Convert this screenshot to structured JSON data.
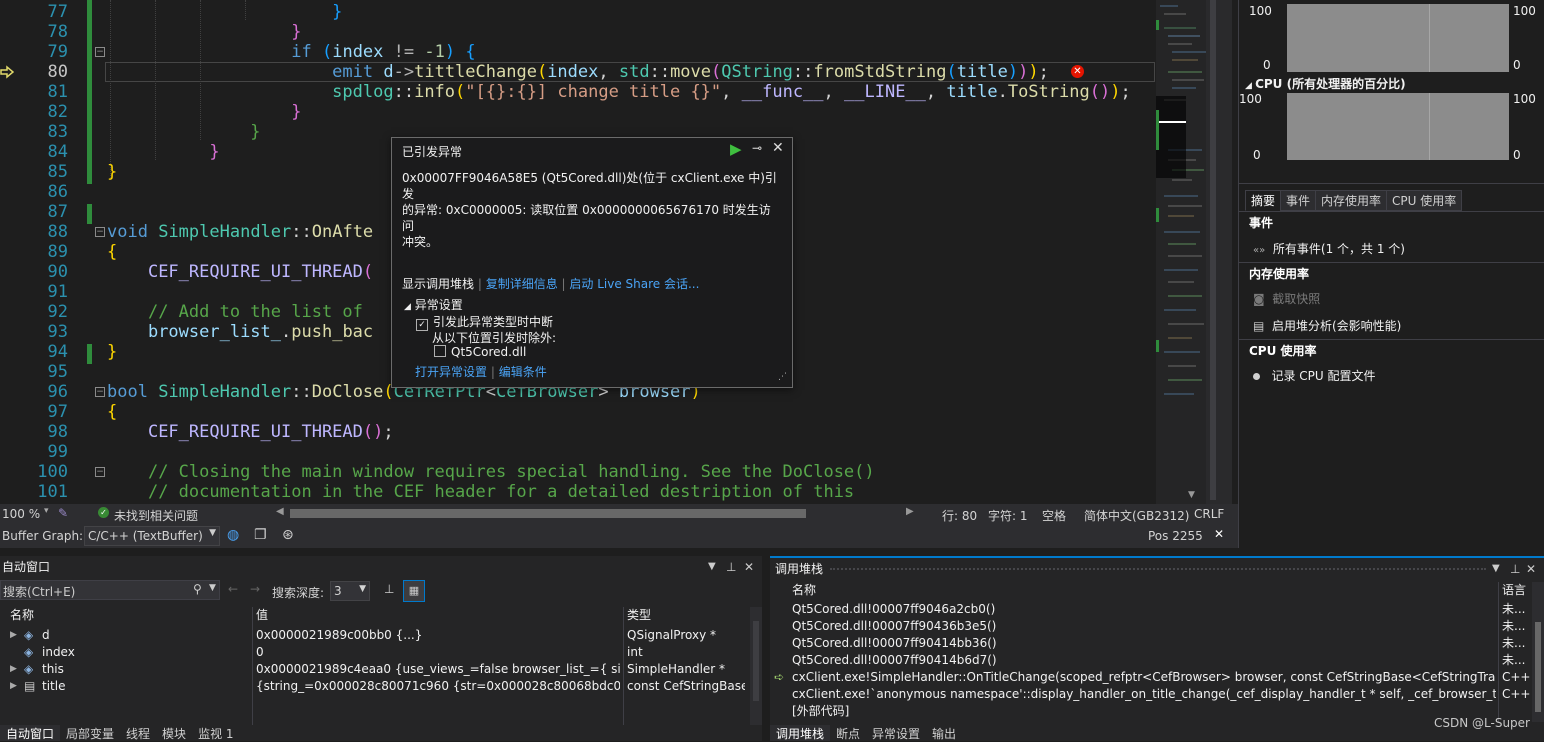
{
  "editor": {
    "lines": [
      {
        "n": "77"
      },
      {
        "n": "78"
      },
      {
        "n": "79"
      },
      {
        "n": "80"
      },
      {
        "n": "81"
      },
      {
        "n": "82"
      },
      {
        "n": "83"
      },
      {
        "n": "84"
      },
      {
        "n": "85"
      },
      {
        "n": "86"
      },
      {
        "n": "87"
      },
      {
        "n": "88"
      },
      {
        "n": "89"
      },
      {
        "n": "90"
      },
      {
        "n": "91"
      },
      {
        "n": "92"
      },
      {
        "n": "93"
      },
      {
        "n": "94"
      },
      {
        "n": "95"
      },
      {
        "n": "96"
      },
      {
        "n": "97"
      },
      {
        "n": "98"
      },
      {
        "n": "99"
      },
      {
        "n": "100"
      },
      {
        "n": "101"
      }
    ],
    "zoom": "100 %",
    "issues": "未找到相关问题",
    "row": "行: 80",
    "col": "字符: 1",
    "whitespace": "空格",
    "encoding": "简体中文(GB2312)",
    "eol": "CRLF",
    "buffer_graph_label": "Buffer Graph:",
    "buffer_graph_value": "C/C++ (TextBuffer)",
    "pos": "Pos 2255"
  },
  "diagnostics": {
    "y_top_left": "100",
    "y_bottom_left": "0",
    "y_top_right": "100",
    "y_bottom_right": "0",
    "cpu_title": "CPU (所有处理器的百分比)",
    "tabs": [
      "摘要",
      "事件",
      "内存使用率",
      "CPU 使用率"
    ],
    "events_header": "事件",
    "events_item": "所有事件(1 个，共 1 个)",
    "memory_header": "内存使用率",
    "snapshot": "截取快照",
    "heap": "启用堆分析(会影响性能)",
    "cpu_header": "CPU 使用率",
    "cpu_item": "记录 CPU 配置文件"
  },
  "exception": {
    "title": "已引发异常",
    "message_1": "0x00007FF9046A58E5 (Qt5Cored.dll)处(位于 cxClient.exe 中)引发",
    "message_2": "的异常: 0xC0000005: 读取位置 0x0000000065676170 时发生访问",
    "message_3": "冲突。",
    "link_callstack": "显示调用堆栈",
    "link_copy": "复制详细信息",
    "link_liveshare": "启动 Live Share 会话...",
    "settings": "异常设置",
    "break_when": "引发此异常类型时中断",
    "except_from": "从以下位置引发时除外:",
    "dll": "Qt5Cored.dll",
    "open_settings": "打开异常设置",
    "edit_conditions": "编辑条件"
  },
  "autos": {
    "title": "自动窗口",
    "search_placeholder": "搜索(Ctrl+E)",
    "depth_label": "搜索深度:",
    "depth_value": "3",
    "columns": [
      "名称",
      "值",
      "类型"
    ],
    "rows": [
      {
        "name": "d",
        "value": "0x0000021989c00bb0 {...}",
        "type": "QSignalProxy *"
      },
      {
        "name": "index",
        "value": "0",
        "type": "int"
      },
      {
        "name": "this",
        "value": "0x0000021989c4eaa0 {use_views_=false browser_list_={ size=1 } is_cl...",
        "type": "SimpleHandler *"
      },
      {
        "name": "title",
        "value": "{string_=0x000028c80071c960 {str=0x000028c80068bdc0 L\"My test p...",
        "type": "const CefStringBase..."
      }
    ],
    "tabs": [
      "自动窗口",
      "局部变量",
      "线程",
      "模块",
      "监视 1"
    ]
  },
  "callstack": {
    "title": "调用堆栈",
    "columns": [
      "名称",
      "语言"
    ],
    "rows": [
      {
        "name": "Qt5Cored.dll!00007ff9046a2cb0()",
        "lang": "未..."
      },
      {
        "name": "Qt5Cored.dll!00007ff90436b3e5()",
        "lang": "未..."
      },
      {
        "name": "Qt5Cored.dll!00007ff90414bb36()",
        "lang": "未..."
      },
      {
        "name": "Qt5Cored.dll!00007ff90414b6d7()",
        "lang": "未..."
      },
      {
        "name": "cxClient.exe!SimpleHandler::OnTitleChange(scoped_refptr<CefBrowser> browser, const CefStringBase<CefStringTraitsUTF16> & titl...",
        "lang": "C++"
      },
      {
        "name": "cxClient.exe!`anonymous namespace'::display_handler_on_title_change(_cef_display_handler_t * self, _cef_browser_t * browser, const...",
        "lang": "C++"
      },
      {
        "name": "[外部代码]",
        "lang": ""
      }
    ],
    "tabs": [
      "调用堆栈",
      "断点",
      "异常设置",
      "输出"
    ]
  },
  "watermark": "CSDN @L-Super",
  "colors": {
    "accent": "#007acc",
    "changed": "#2f8c3c",
    "error": "#e51400",
    "link": "#4aa3f5"
  }
}
